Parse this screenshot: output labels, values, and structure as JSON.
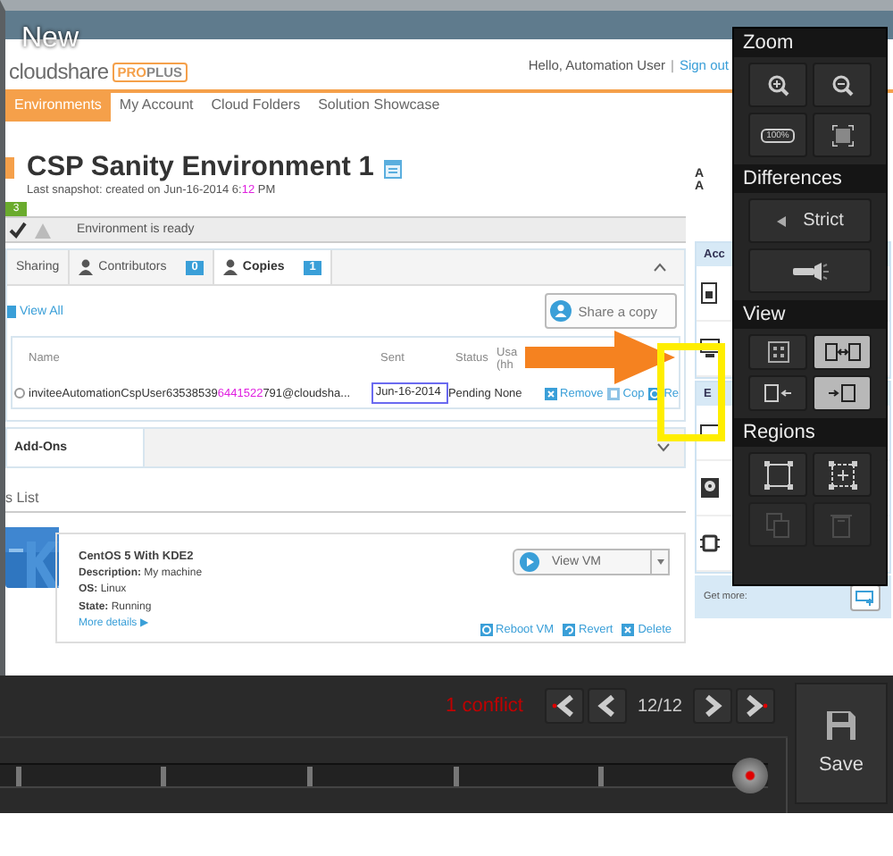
{
  "browser": {
    "badge": "New"
  },
  "header": {
    "logo": "cloudshare",
    "edition": [
      "PRO",
      "PLUS"
    ],
    "greeting": "Hello, Automation User",
    "separator": "|",
    "sign_out": "Sign out"
  },
  "nav": [
    {
      "label": "Environments",
      "selected": true
    },
    {
      "label": "My Account",
      "selected": false
    },
    {
      "label": "Cloud Folders",
      "selected": false
    },
    {
      "label": "Solution Showcase",
      "selected": false
    }
  ],
  "environment": {
    "title": "CSP Sanity Environment 1",
    "snapshot": [
      {
        "text": "Last snapshot: created on Jun-16-2014 6:",
        "changed": false
      },
      {
        "text": "12",
        "changed": true
      },
      {
        "text": " PM",
        "changed": false
      }
    ],
    "count": "3",
    "status": "Environment is ready"
  },
  "sharing": {
    "tabs": [
      {
        "label": "Sharing",
        "selected": false
      },
      {
        "label": "Contributors",
        "count": "0",
        "selected": false
      },
      {
        "label": "Copies",
        "count": "1",
        "selected": true
      }
    ],
    "view_all": "View All",
    "share_button": "Share a copy",
    "columns": [
      "Name",
      "Sent",
      "Status",
      "Usa (hh"
    ],
    "rows": [
      {
        "name": [
          {
            "text": "inviteeAutomationCspUser63538539",
            "changed": false
          },
          {
            "text": "6441522",
            "changed": true
          },
          {
            "text": "791@cloudsha...",
            "changed": false
          }
        ],
        "sent": "Jun-16-2014",
        "sent_highlighted": true,
        "status": "Pending",
        "usage": "None",
        "actions": [
          "Remove",
          "Cop",
          "Re"
        ]
      }
    ]
  },
  "addons": {
    "title": "Add-Ons"
  },
  "vm_list": {
    "title": "s List",
    "machines": [
      {
        "name": "CentOS 5 With KDE2",
        "details": [
          {
            "label": "Description:",
            "value": "My machine"
          },
          {
            "label": "OS:",
            "value": "Linux"
          },
          {
            "label": "State:",
            "value": "Running"
          }
        ],
        "more": "More details ▶",
        "view_button": "View VM",
        "actions": [
          "Reboot VM",
          "Revert",
          "Delete"
        ]
      }
    ]
  },
  "sidebar": {
    "fragments": [
      "A",
      "A"
    ],
    "sections": [
      {
        "title": "Acc",
        "items": [
          {
            "kind": "document"
          },
          {
            "kind": "monitor"
          }
        ]
      },
      {
        "title": "E",
        "items": [
          {
            "kind": "screen"
          },
          {
            "kind": "disk"
          },
          {
            "kind": "chip"
          }
        ]
      }
    ],
    "get_more": "Get more:"
  },
  "palette": {
    "sections": [
      {
        "title": "Zoom",
        "buttons": [
          {
            "kind": "zoomin"
          },
          {
            "kind": "zoomout"
          },
          {
            "kind": "label",
            "text": "100%"
          },
          {
            "kind": "fit"
          }
        ]
      },
      {
        "title": "Differences",
        "buttons": [
          {
            "kind": "mode",
            "text": "Strict"
          },
          {
            "kind": "flashlight"
          }
        ]
      },
      {
        "title": "View",
        "buttons": [
          {
            "kind": "grid",
            "selected": false
          },
          {
            "kind": "split",
            "selected": true
          },
          {
            "kind": "left",
            "selected": false
          },
          {
            "kind": "right",
            "selected": true
          }
        ]
      },
      {
        "title": "Regions",
        "buttons": [
          {
            "kind": "rect",
            "disabled": false
          },
          {
            "kind": "select",
            "disabled": false
          },
          {
            "kind": "copy",
            "disabled": true
          },
          {
            "kind": "trash",
            "disabled": true
          }
        ]
      }
    ]
  },
  "timeline": {
    "conflicts": "1 conflict",
    "counter": "12/12",
    "save": "Save",
    "level": 1
  }
}
